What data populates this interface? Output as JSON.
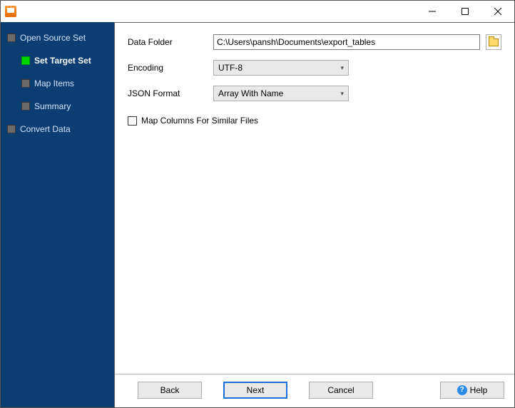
{
  "window": {
    "title": ""
  },
  "sidebar": {
    "items": [
      {
        "label": "Open Source Set",
        "level": "top",
        "active": false
      },
      {
        "label": "Set Target Set",
        "level": "child",
        "active": true
      },
      {
        "label": "Map Items",
        "level": "child",
        "active": false
      },
      {
        "label": "Summary",
        "level": "child",
        "active": false
      },
      {
        "label": "Convert Data",
        "level": "top",
        "active": false
      }
    ]
  },
  "form": {
    "data_folder_label": "Data Folder",
    "data_folder_value": "C:\\Users\\pansh\\Documents\\export_tables",
    "encoding_label": "Encoding",
    "encoding_value": "UTF-8",
    "json_format_label": "JSON Format",
    "json_format_value": "Array With Name",
    "map_columns_label": "Map Columns For Similar Files",
    "map_columns_checked": false
  },
  "buttons": {
    "back": "Back",
    "next": "Next",
    "cancel": "Cancel",
    "help": "Help"
  }
}
